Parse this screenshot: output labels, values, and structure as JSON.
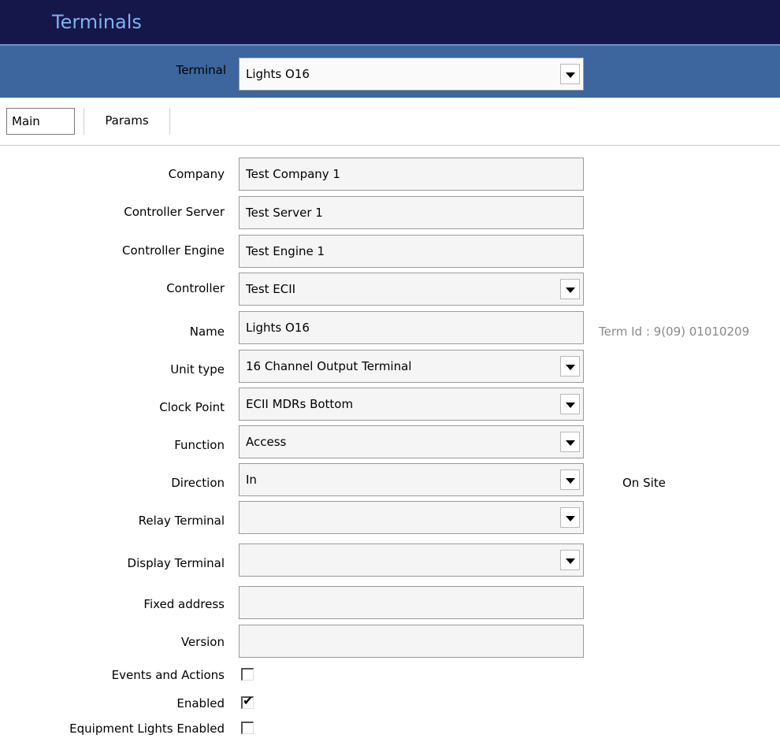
{
  "window": {
    "title": "Terminals"
  },
  "terminal_selector": {
    "label": "Terminal",
    "value": "Lights O16"
  },
  "tabs": [
    {
      "label": "Main",
      "active": true
    },
    {
      "label": "Params",
      "active": false
    }
  ],
  "form": {
    "company": {
      "label": "Company",
      "value": "Test Company 1"
    },
    "controller_server": {
      "label": "Controller Server",
      "value": "Test Server 1"
    },
    "controller_engine": {
      "label": "Controller Engine",
      "value": "Test Engine 1"
    },
    "controller": {
      "label": "Controller",
      "value": "Test ECII"
    },
    "name": {
      "label": "Name",
      "value": "Lights O16"
    },
    "term_id": "Term Id : 9(09) 01010209",
    "unit_type": {
      "label": "Unit type",
      "value": "16 Channel Output Terminal"
    },
    "clock_point": {
      "label": "Clock Point",
      "value": "ECII MDRs Bottom"
    },
    "function": {
      "label": "Function",
      "value": "Access"
    },
    "direction": {
      "label": "Direction",
      "value": "In"
    },
    "on_site": "On Site",
    "relay_terminal": {
      "label": "Relay Terminal",
      "value": ""
    },
    "display_terminal": {
      "label": "Display Terminal",
      "value": ""
    },
    "fixed_address": {
      "label": "Fixed address",
      "value": ""
    },
    "version": {
      "label": "Version",
      "value": ""
    },
    "events_and_actions": {
      "label": "Events and Actions",
      "checked": false
    },
    "enabled": {
      "label": "Enabled",
      "checked": true,
      "mark": "✔"
    },
    "equipment_lights_enabled": {
      "label": "Equipment Lights Enabled",
      "checked": false
    }
  },
  "colors": {
    "title_bar": "#15174a",
    "title_text": "#7fb2ee",
    "terminal_bar": "#3d669e"
  }
}
